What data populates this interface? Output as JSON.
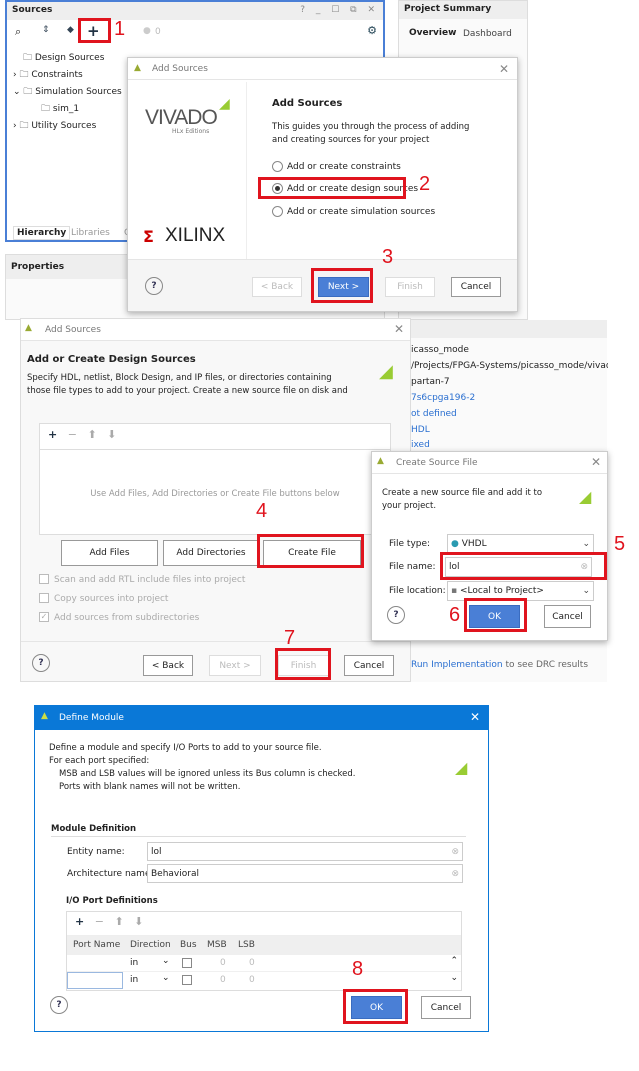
{
  "sources_panel": {
    "title": "Sources",
    "header_icons": [
      "help-icon",
      "minimize-icon",
      "maximize-icon",
      "float-icon",
      "close-icon"
    ],
    "badge_count": "0",
    "tree": [
      "Design Sources",
      "Constraints",
      "Simulation Sources",
      "sim_1",
      "Utility Sources"
    ],
    "tabs": [
      "Hierarchy",
      "Libraries",
      "C"
    ]
  },
  "properties_panel": {
    "title": "Properties"
  },
  "project_summary": {
    "title": "Project Summary",
    "tabs": [
      "Overview",
      "Dashboard"
    ],
    "values": [
      "icasso_mode",
      "/Projects/FPGA-Systems/picasso_mode/vivado/p",
      "partan-7",
      "7s6cpga196-2",
      "ot defined",
      "HDL",
      "ixed"
    ],
    "drc_link": "Run Implementation",
    "drc_text": "to see DRC results"
  },
  "add_sources_1": {
    "title": "Add Sources",
    "brand_top": "VIVADO",
    "brand_sub": "HLx Editions",
    "brand_bottom": "XILINX",
    "heading": "Add Sources",
    "desc": "This guides you through the process of adding and creating sources for your project",
    "options": [
      "Add or create constraints",
      "Add or create design sources",
      "Add or create simulation sources"
    ],
    "selected": 1,
    "back": "< Back",
    "next": "Next >",
    "finish": "Finish",
    "cancel": "Cancel"
  },
  "add_sources_2": {
    "title": "Add Sources",
    "heading": "Add or Create Design Sources",
    "desc": "Specify HDL, netlist, Block Design, and IP files, or directories containing those file types to add to your project. Create a new source file on disk and add it to your",
    "empty": "Use Add Files, Add Directories or Create File buttons below",
    "add_files": "Add Files",
    "add_dirs": "Add Directories",
    "create_file": "Create File",
    "checks": [
      {
        "label": "Scan and add RTL include files into project",
        "checked": false
      },
      {
        "label": "Copy sources into project",
        "checked": false
      },
      {
        "label": "Add sources from subdirectories",
        "checked": true
      }
    ],
    "back": "< Back",
    "next": "Next >",
    "finish": "Finish",
    "cancel": "Cancel"
  },
  "create_source": {
    "title": "Create Source File",
    "desc": "Create a new source file and add it to your project.",
    "file_type_label": "File type:",
    "file_type": "VHDL",
    "file_name_label": "File name:",
    "file_name": "lol",
    "file_location_label": "File location:",
    "file_location": "<Local to Project>",
    "ok": "OK",
    "cancel": "Cancel"
  },
  "define_module": {
    "title": "Define Module",
    "desc": [
      "Define a module and specify I/O Ports to add to your source file.",
      "For each port specified:",
      "MSB and LSB values will be ignored unless its Bus column is checked.",
      "Ports with blank names will not be written."
    ],
    "module_def": "Module Definition",
    "entity_label": "Entity name:",
    "entity": "lol",
    "arch_label": "Architecture name:",
    "arch": "Behavioral",
    "io_title": "I/O Port Definitions",
    "columns": [
      "Port Name",
      "Direction",
      "Bus",
      "MSB",
      "LSB"
    ],
    "rows": [
      {
        "name": "",
        "dir": "in",
        "bus": false,
        "msb": "0",
        "lsb": "0"
      },
      {
        "name": "",
        "dir": "in",
        "bus": false,
        "msb": "0",
        "lsb": "0"
      }
    ],
    "ok": "OK",
    "cancel": "Cancel"
  },
  "steps": [
    "1",
    "2",
    "3",
    "4",
    "5",
    "6",
    "7",
    "8"
  ],
  "colors": {
    "highlight": "#e0141e",
    "primary": "#4a7fd6",
    "titlebar": "#0a78d7"
  }
}
